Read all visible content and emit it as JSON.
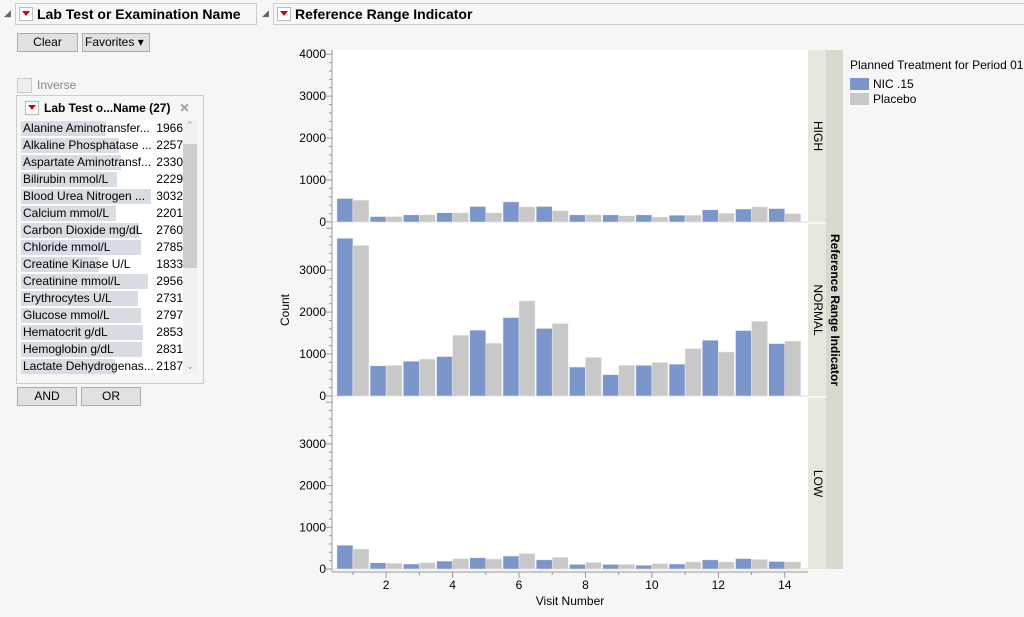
{
  "filter": {
    "title": "Lab Test or Examination Name",
    "clear": "Clear",
    "favorites": "Favorites",
    "inverse": "Inverse",
    "list_title": "Lab Test o...Name (27)",
    "and": "AND",
    "or": "OR",
    "items": [
      {
        "name": "Alanine Aminotransfer...",
        "count": "1966",
        "frac": 0.65
      },
      {
        "name": "Alkaline Phosphatase ...",
        "count": "2257",
        "frac": 0.75
      },
      {
        "name": "Aspartate Aminotransf...",
        "count": "2330",
        "frac": 0.77
      },
      {
        "name": "Bilirubin mmol/L",
        "count": "2229",
        "frac": 0.74
      },
      {
        "name": "Blood Urea Nitrogen ...",
        "count": "3032",
        "frac": 1.0
      },
      {
        "name": "Calcium mmol/L",
        "count": "2201",
        "frac": 0.73
      },
      {
        "name": "Carbon Dioxide mg/dL",
        "count": "2760",
        "frac": 0.91
      },
      {
        "name": "Chloride mmol/L",
        "count": "2785",
        "frac": 0.92
      },
      {
        "name": "Creatine Kinase U/L",
        "count": "1833",
        "frac": 0.6
      },
      {
        "name": "Creatinine mmol/L",
        "count": "2956",
        "frac": 0.98
      },
      {
        "name": "Erythrocytes U/L",
        "count": "2731",
        "frac": 0.9
      },
      {
        "name": "Glucose mmol/L",
        "count": "2797",
        "frac": 0.92
      },
      {
        "name": "Hematocrit g/dL",
        "count": "2853",
        "frac": 0.94
      },
      {
        "name": "Hemoglobin g/dL",
        "count": "2831",
        "frac": 0.93
      },
      {
        "name": "Lactate Dehydrogenas...",
        "count": "2187",
        "frac": 0.72
      }
    ]
  },
  "chart_data": {
    "type": "bar",
    "title": "Reference Range Indicator",
    "xlabel": "Visit Number",
    "ylabel": "Count",
    "x": [
      1,
      2,
      3,
      4,
      5,
      6,
      7,
      8,
      9,
      10,
      11,
      12,
      13,
      14
    ],
    "xticks": [
      2,
      4,
      6,
      8,
      10,
      12,
      14
    ],
    "ylim": [
      0,
      4100
    ],
    "legend_title": "Planned Treatment for Period 01",
    "legend_position": "right",
    "strip_label": "Reference Range Indicator",
    "series_meta": [
      {
        "name": "NIC .15",
        "color": "#7b96cb"
      },
      {
        "name": "Placebo",
        "color": "#c8c8c8"
      }
    ],
    "panels": [
      {
        "name": "HIGH",
        "yticks": [
          0,
          1000,
          2000,
          3000,
          4000
        ],
        "series": [
          {
            "name": "NIC .15",
            "values": [
              560,
              130,
              170,
              220,
              370,
              480,
              370,
              170,
              170,
              170,
              160,
              290,
              310,
              320
            ]
          },
          {
            "name": "Placebo",
            "values": [
              520,
              130,
              170,
              220,
              220,
              360,
              270,
              170,
              150,
              120,
              160,
              210,
              360,
              200
            ]
          }
        ]
      },
      {
        "name": "NORMAL",
        "yticks": [
          0,
          1000,
          2000,
          3000
        ],
        "series": [
          {
            "name": "NIC .15",
            "values": [
              3760,
              720,
              830,
              940,
              1570,
              1870,
              1610,
              690,
              510,
              730,
              760,
              1330,
              1560,
              1250
            ]
          },
          {
            "name": "Placebo",
            "values": [
              3590,
              730,
              880,
              1450,
              1260,
              2270,
              1730,
              920,
              730,
              800,
              1130,
              1050,
              1780,
              1310
            ]
          }
        ]
      },
      {
        "name": "LOW",
        "yticks": [
          0,
          1000,
          2000,
          3000
        ],
        "series": [
          {
            "name": "NIC .15",
            "values": [
              570,
              150,
              120,
              190,
              270,
              310,
              220,
              110,
              110,
              90,
              120,
              220,
              250,
              180
            ]
          },
          {
            "name": "Placebo",
            "values": [
              480,
              140,
              150,
              250,
              240,
              370,
              280,
              160,
              110,
              130,
              170,
              170,
              230,
              170
            ]
          }
        ]
      }
    ]
  }
}
